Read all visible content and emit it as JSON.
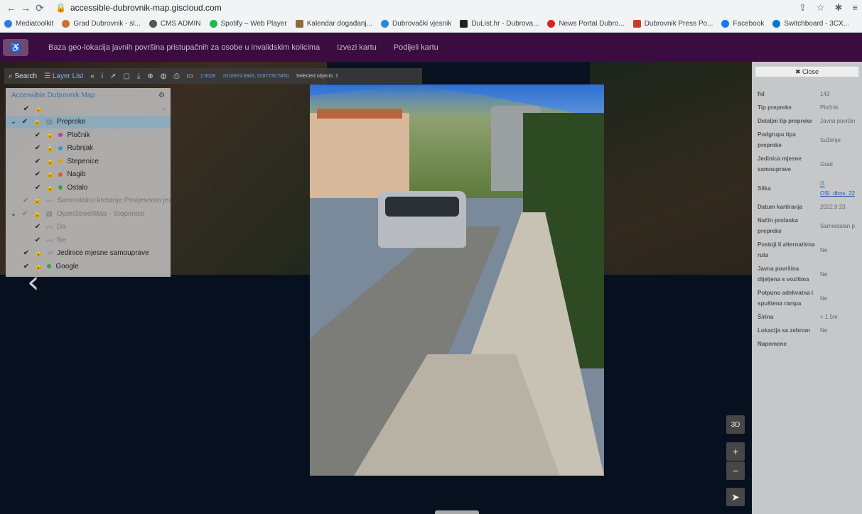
{
  "browser": {
    "url": "accessible-dubrovnik-map.giscloud.com",
    "bookmarks": [
      {
        "label": "Mediatoolkit",
        "color": "#2d7be5"
      },
      {
        "label": "Grad Dubrovnik - sl...",
        "color": "#c8732a"
      },
      {
        "label": "CMS ADMIN",
        "color": "#555555"
      },
      {
        "label": "Spotify – Web Player",
        "color": "#1db954"
      },
      {
        "label": "Kalendar događanj...",
        "color": "#8a6d3b"
      },
      {
        "label": "Dubrovački vjesnik",
        "color": "#2a8ad8"
      },
      {
        "label": "DuList.hr - Dubrova...",
        "color": "#222222"
      },
      {
        "label": "News Portal Dubro...",
        "color": "#e02020"
      },
      {
        "label": "Dubrovnik Press Po...",
        "color": "#c0402a"
      },
      {
        "label": "Facebook",
        "color": "#1877f2"
      },
      {
        "label": "Switchboard - 3CX...",
        "color": "#0078d4"
      }
    ]
  },
  "header": {
    "title": "Baza geo-lokacija javnih površina pristupačnih za osobe u invalidskim kolicima",
    "export": "Izvezi kartu",
    "share": "Podijeli kartu"
  },
  "toolbar": {
    "search": "Search",
    "layer_list": "Layer List",
    "scale": "1:9028",
    "coords": "2016974.5843, 5287730.5450",
    "selected": "Selected objects: 1"
  },
  "layers": {
    "root": "Accessible Dubrovnik Map",
    "items": [
      {
        "label": "Prepreke",
        "color": ""
      },
      {
        "label": "Pločnik",
        "color": "#c83a8a"
      },
      {
        "label": "Rubnjak",
        "color": "#2a9ad0"
      },
      {
        "label": "Stepenice",
        "color": "#d8a020"
      },
      {
        "label": "Nagib",
        "color": "#d85a2a"
      },
      {
        "label": "Ostalo",
        "color": "#3aa03a"
      },
      {
        "label": "Samostalno kretanje Povijesnom jezgr",
        "color": ""
      },
      {
        "label": "OpenStreetMap - Stepenice",
        "color": ""
      },
      {
        "label": "Da",
        "color": ""
      },
      {
        "label": "Ne",
        "color": ""
      },
      {
        "label": "Jedinice mjesne samouprave",
        "color": ""
      },
      {
        "label": "Google",
        "color": "#3aa03a"
      }
    ]
  },
  "attributes": {
    "close": "Close",
    "rows": [
      {
        "key": "fid",
        "value": "143"
      },
      {
        "key": "Tip prepreke",
        "value": "Pločnik"
      },
      {
        "key": "Detaljni tip prepreke",
        "value": "Javna površin"
      },
      {
        "key": "Podgrupa tipa prepreke",
        "value": "Suženje"
      },
      {
        "key": "Jedinica mjesne samouprave",
        "value": "Grad"
      },
      {
        "key": "Slika",
        "value": "OSI_dbos_22"
      },
      {
        "key": "Datum kartiranja",
        "value": "2022.9.23."
      },
      {
        "key": "Način prolaska prepreke",
        "value": "Samostalan p"
      },
      {
        "key": "Postoji li alternativna ruta",
        "value": "Ne"
      },
      {
        "key": "Javna površina dijeljena s vozilima",
        "value": "Ne"
      },
      {
        "key": "Potpuno adekvatna i spuštena rampa",
        "value": "Ne"
      },
      {
        "key": "Širina",
        "value": "> 1.5m"
      },
      {
        "key": "Lokacija sa zebrom",
        "value": "Ne"
      },
      {
        "key": "Napomene",
        "value": ""
      }
    ]
  },
  "controls": {
    "three_d": "3D",
    "zoom_in": "+",
    "zoom_out": "−"
  }
}
